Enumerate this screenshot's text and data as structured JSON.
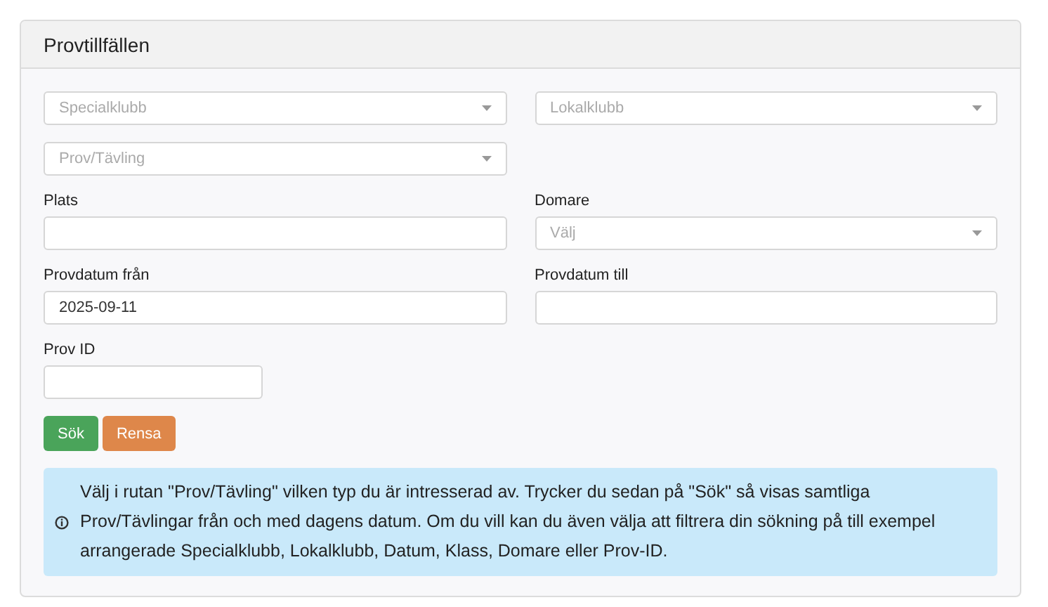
{
  "panel": {
    "title": "Provtillfällen"
  },
  "rows": [
    [
      {
        "kind": "select",
        "placeholder": "Specialklubb"
      },
      {
        "kind": "select",
        "placeholder": "Lokalklubb"
      }
    ],
    [
      {
        "kind": "select",
        "placeholder": "Prov/Tävling"
      }
    ],
    [
      {
        "kind": "text",
        "label": "Plats"
      },
      {
        "kind": "select",
        "label": "Domare",
        "placeholder": "Välj"
      }
    ],
    [
      {
        "kind": "text",
        "label": "Provdatum från",
        "value": "2025-09-11"
      },
      {
        "kind": "text",
        "label": "Provdatum till"
      }
    ],
    [
      {
        "kind": "short",
        "label": "Prov ID"
      }
    ]
  ],
  "buttons": [
    {
      "label": "Sök",
      "kind": "primary"
    },
    {
      "label": "Rensa",
      "kind": "reset"
    }
  ],
  "info": {
    "text": "Välj i rutan \"Prov/Tävling\" vilken typ du är intresserad av. Trycker du sedan på \"Sök\" så visas samtliga Prov/Tävlingar från och med dagens datum. Om du vill kan du även välja att filtrera din sökning på till exempel arrangerade Specialklubb, Lokalklubb, Datum, Klass, Domare eller Prov-ID."
  }
}
